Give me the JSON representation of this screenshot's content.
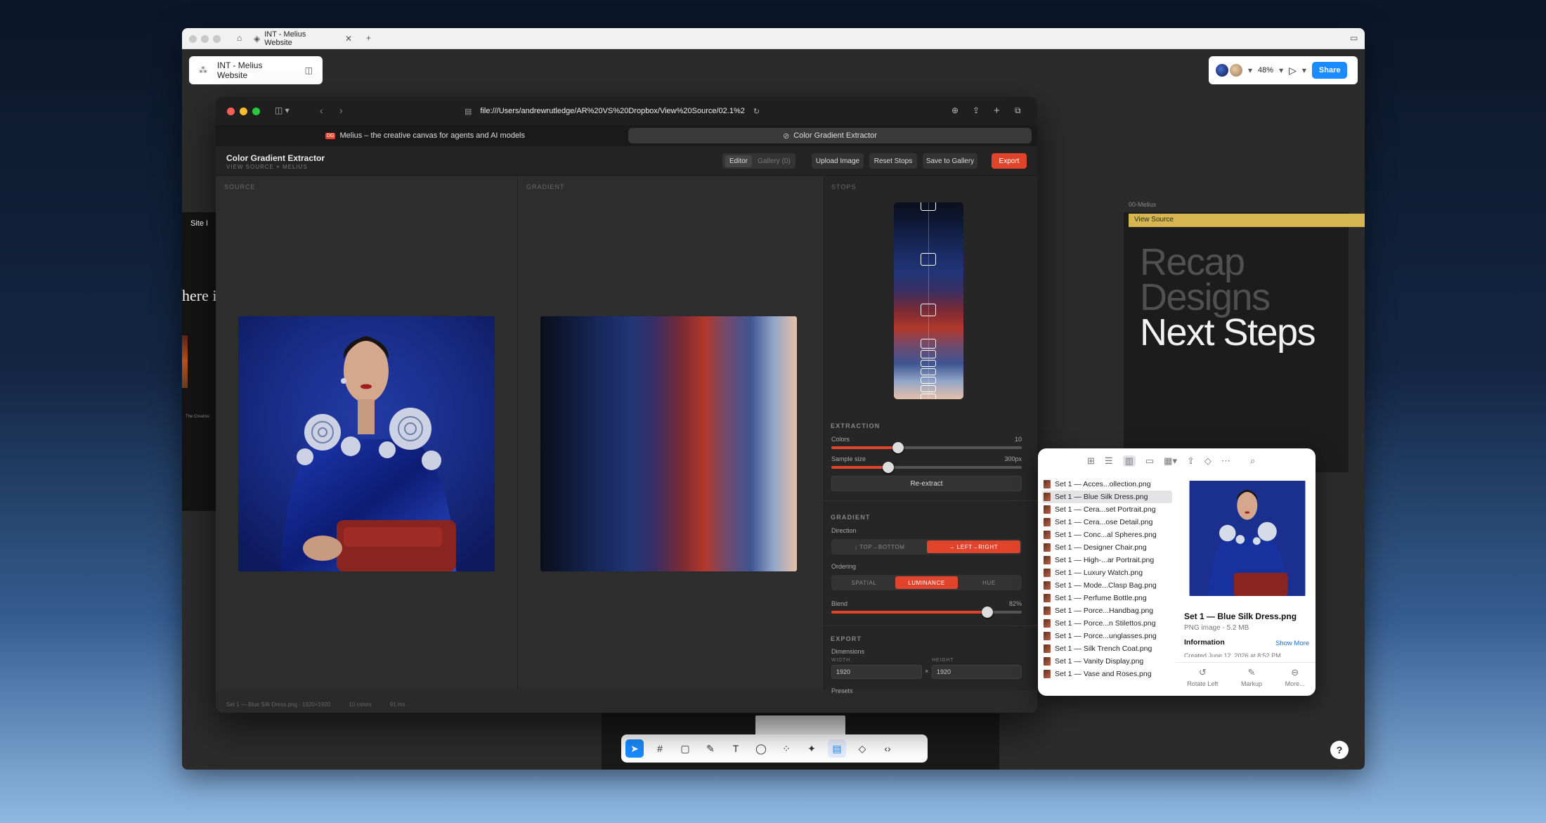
{
  "outer": {
    "tab_title": "INT - Melius Website",
    "project_name": "INT - Melius Website",
    "zoom": "48%",
    "share_label": "Share"
  },
  "browser": {
    "url": "file:///Users/andrewrutledge/AR%20VS%20Dropbox/View%20Source/02.1%2",
    "tabs": [
      {
        "label": "Melius – the creative canvas for agents and AI models"
      },
      {
        "label": "Color Gradient Extractor"
      }
    ]
  },
  "app": {
    "title": "Color Gradient Extractor",
    "subtitle": "VIEW SOURCE × MELIUS",
    "nav": {
      "editor": "Editor",
      "gallery": "Gallery",
      "gallery_count": "(0)"
    },
    "buttons": {
      "upload": "Upload Image",
      "reset": "Reset Stops",
      "save": "Save to Gallery",
      "export": "Export"
    },
    "panes": {
      "source": "SOURCE",
      "gradient": "GRADIENT",
      "stops": "STOPS"
    },
    "extraction": {
      "heading": "EXTRACTION",
      "colors_label": "Colors",
      "colors_value": "10",
      "colors_fill": 0.35,
      "sample_label": "Sample size",
      "sample_value": "300px",
      "sample_fill": 0.3,
      "reextract": "Re-extract"
    },
    "gradient": {
      "heading": "GRADIENT",
      "direction_label": "Direction",
      "direction_options": [
        "↓ TOP→BOTTOM",
        "→ LEFT→RIGHT"
      ],
      "direction_selected": "→ LEFT→RIGHT",
      "ordering_label": "Ordering",
      "ordering_options": [
        "SPATIAL",
        "LUMINANCE",
        "HUE"
      ],
      "ordering_selected": "LUMINANCE",
      "blend_label": "Blend",
      "blend_value": "82%",
      "blend_fill": 0.82
    },
    "export": {
      "heading": "EXPORT",
      "dimensions_label": "Dimensions",
      "width_label": "WIDTH",
      "width_value": "1920",
      "height_label": "HEIGHT",
      "height_value": "1920",
      "times": "×",
      "presets_label": "Presets"
    },
    "status": {
      "file": "Set 1 — Blue Silk Dress.png · 1920×1920",
      "colors": "10 colors",
      "time": "91 ms"
    },
    "gradient_colors": [
      "#0b0f1c",
      "#0e1733",
      "#13224d",
      "#1a2c66",
      "#223577",
      "#3a2e63",
      "#7a2a34",
      "#b2382c",
      "#6f4a6e",
      "#3e5592",
      "#93a6c9",
      "#e7c0a8"
    ]
  },
  "slide_right": {
    "tag": "00-Melius",
    "band": "View Source",
    "line1": "Recap",
    "line2": "Designs",
    "line3": "Next Steps"
  },
  "slide_left": {
    "label": "Site I",
    "big": "here ic",
    "tiny": "The Creative"
  },
  "finder": {
    "files": [
      "Set 1 — Acces...ollection.png",
      "Set 1 — Blue Silk Dress.png",
      "Set 1 — Cera...set Portrait.png",
      "Set 1 — Cera...ose Detail.png",
      "Set 1 — Conc...al Spheres.png",
      "Set 1 — Designer Chair.png",
      "Set 1 — High-...ar Portrait.png",
      "Set 1 — Luxury Watch.png",
      "Set 1 — Mode...Clasp Bag.png",
      "Set 1 — Perfume Bottle.png",
      "Set 1 — Porce...Handbag.png",
      "Set 1 — Porce...n Stilettos.png",
      "Set 1 — Porce...unglasses.png",
      "Set 1 — Silk Trench Coat.png",
      "Set 1 — Vanity Display.png",
      "Set 1 — Vase and Roses.png"
    ],
    "selected": "Set 1 — Blue Silk Dress.png",
    "preview_title": "Set 1 — Blue Silk Dress.png",
    "preview_meta": "PNG image - 5.2 MB",
    "info_label": "Information",
    "show_more": "Show More",
    "created": "Created       June 12, 2026 at 8:52 PM",
    "actions": [
      "Rotate Left",
      "Markup",
      "More..."
    ]
  }
}
